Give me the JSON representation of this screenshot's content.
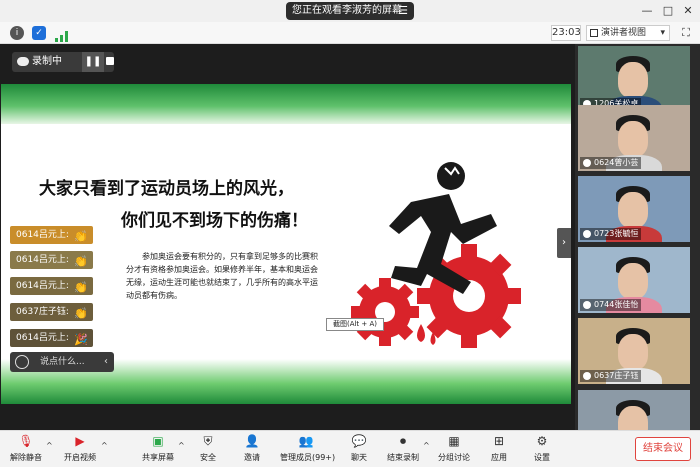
{
  "titlebar": {
    "share_status": "您正在观看李淑芳的屏幕",
    "menu_icon": "menu-icon",
    "minimize": "—",
    "restore": "□",
    "close": "✕"
  },
  "toolbar": {
    "timer": "23:03",
    "view_mode": "演讲者视图",
    "caret": "▾"
  },
  "recording": {
    "label": "录制中",
    "pause_glyph": "❚❚"
  },
  "slide": {
    "headline1": "大家只看到了运动员场上的风光，",
    "headline2": "你们见不到场下的伤痛！",
    "paragraph": "参加奥运会要有积分的，只有拿到足够多的比赛积分才有资格参加奥运会。如果修养半年，基本和奥运会无缘，运动生涯可能也就结束了，几乎所有的高水平运动员都有伤病。"
  },
  "screenshot_tip": "截图(Alt + A)",
  "chat": {
    "messages": [
      {
        "text": "0614吕元上:",
        "emoji": "👏"
      },
      {
        "text": "0614吕元上:",
        "emoji": "👏"
      },
      {
        "text": "0614吕元上:",
        "emoji": "👏"
      },
      {
        "text": "0637庄子钰:",
        "emoji": "👏"
      },
      {
        "text": "0614吕元上:",
        "emoji": "🎉"
      }
    ],
    "input_placeholder": "说点什么...",
    "collapse_glyph": "‹"
  },
  "gallery": {
    "collapse_glyph": "›",
    "participants": [
      {
        "name": "1206关松卓"
      },
      {
        "name": "0624曾小芸"
      },
      {
        "name": "0723张毓恒"
      },
      {
        "name": "0744张佳怡"
      },
      {
        "name": "0637庄子钰"
      },
      {
        "name": ""
      }
    ]
  },
  "bottombar": {
    "items": [
      {
        "label": "解除静音",
        "icon": "muted-mic-icon"
      },
      {
        "label": "开启视频",
        "icon": "video-off-icon"
      },
      {
        "label": "共享屏幕",
        "icon": "share-screen-icon"
      },
      {
        "label": "安全",
        "icon": "shield-icon"
      },
      {
        "label": "邀请",
        "icon": "invite-icon"
      },
      {
        "label": "管理成员(99+)",
        "icon": "members-icon"
      },
      {
        "label": "聊天",
        "icon": "chat-icon"
      },
      {
        "label": "结束录制",
        "icon": "stop-record-icon"
      },
      {
        "label": "分组讨论",
        "icon": "breakout-icon"
      },
      {
        "label": "应用",
        "icon": "apps-icon"
      },
      {
        "label": "设置",
        "icon": "gear-icon"
      }
    ],
    "end_meeting": "结束会议",
    "caret": "^"
  },
  "colors": {
    "accent_red": "#e0443e",
    "slide_green": "#1f8a3a",
    "chat_bubble": "#c98d2a",
    "recording_bg": "#3a3a3a"
  }
}
